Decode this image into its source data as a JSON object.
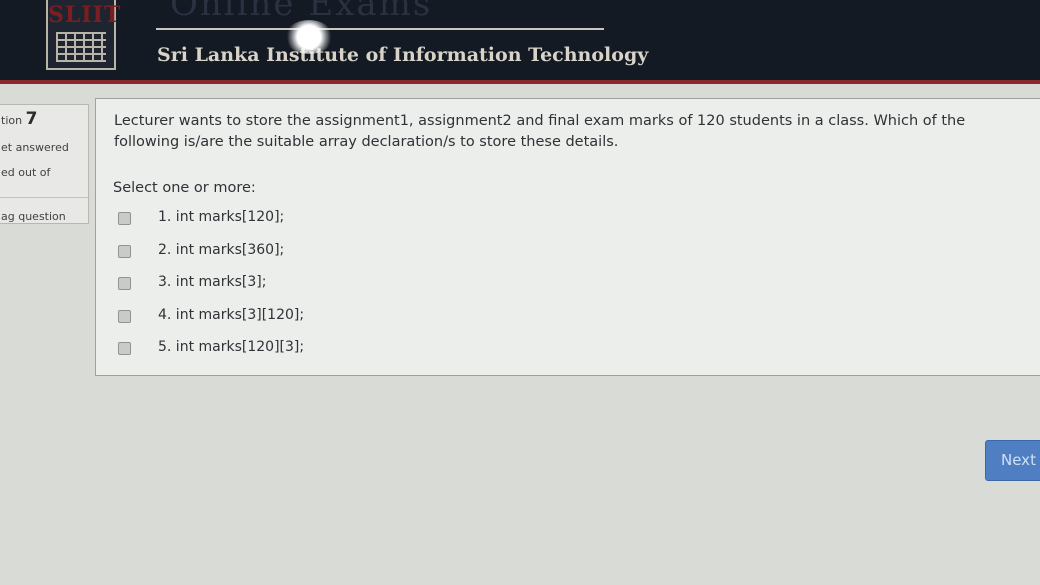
{
  "header": {
    "logo_text": "SLIIT",
    "site_title": "Online Exams",
    "subtitle": "Sri Lanka Institute of Information Technology"
  },
  "info": {
    "question_prefix": "tion",
    "question_number": "7",
    "status": "et answered",
    "marked": "ed out of",
    "flag": "ag question"
  },
  "question": {
    "text": "Lecturer wants to store the assignment1, assignment2 and final exam marks of 120 students in a class. Which of the following is/are the suitable array declaration/s to store these details.",
    "prompt": "Select one or more:",
    "options": [
      {
        "label": "1. int marks[120];",
        "checked": false
      },
      {
        "label": "2. int marks[360];",
        "checked": false
      },
      {
        "label": "3. int marks[3];",
        "checked": false
      },
      {
        "label": "4. int marks[3][120];",
        "checked": false
      },
      {
        "label": "5. int marks[120][3];",
        "checked": false
      }
    ]
  },
  "nav": {
    "next_label": "Next"
  },
  "colors": {
    "header_bg": "#141a24",
    "accent": "#8a2a2a",
    "button": "#4f7ec2"
  }
}
